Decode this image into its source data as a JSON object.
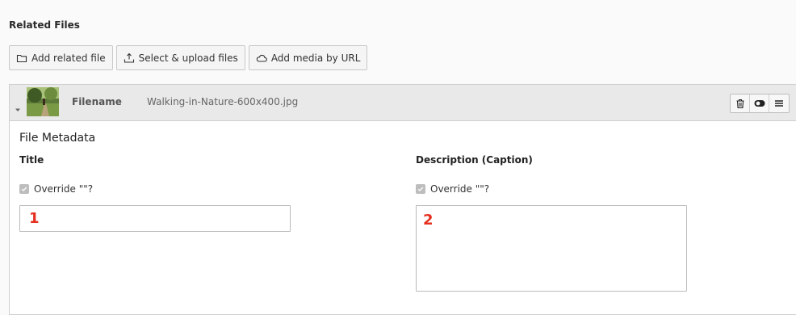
{
  "section": {
    "title": "Related Files"
  },
  "toolbar": {
    "add_related_file": "Add related file",
    "select_upload": "Select & upload files",
    "add_media_url": "Add media by URL"
  },
  "file": {
    "filename_label": "Filename",
    "filename_value": "Walking-in-Nature-600x400.jpg"
  },
  "metadata": {
    "heading": "File Metadata",
    "title_field": {
      "label": "Title",
      "override_label": "Override \"\"?",
      "override_checked": true,
      "value": "",
      "marker": "1"
    },
    "description_field": {
      "label": "Description (Caption)",
      "override_label": "Override \"\"?",
      "override_checked": true,
      "value": "",
      "marker": "2"
    }
  },
  "icons": {
    "add_related_file": "folder-icon",
    "select_upload": "upload-icon",
    "add_media_url": "cloud-icon",
    "collapse": "caret-down-icon",
    "delete": "trash-icon",
    "toggle": "toggle-icon",
    "menu": "hamburger-icon"
  },
  "colors": {
    "marker": "#e53020",
    "header_bg": "#e9e9e9"
  }
}
